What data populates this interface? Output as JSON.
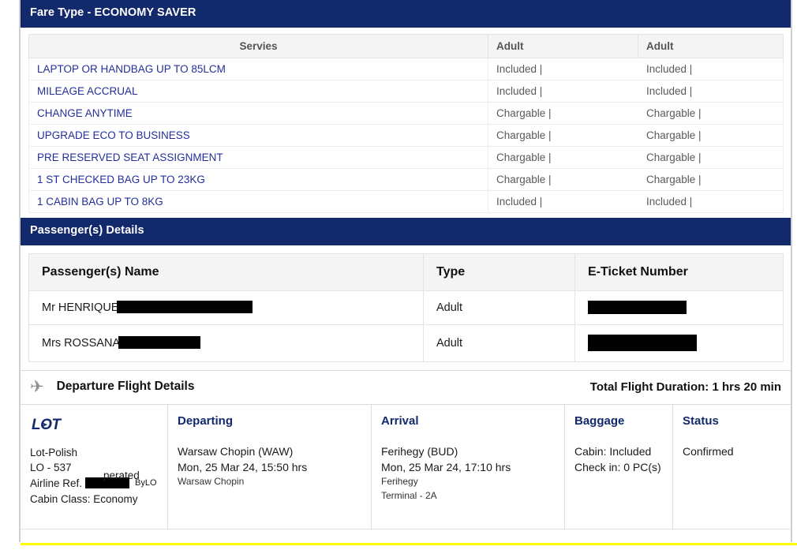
{
  "fare_section": {
    "title_prefix": "Fare Type",
    "title_dash": "-",
    "title_value": "ECONOMY SAVER",
    "columns": [
      "Servies",
      "Adult",
      "Adult"
    ],
    "rows": [
      {
        "service": "LAPTOP OR HANDBAG UP TO 85LCM",
        "adult1": "Included |",
        "adult2": "Included |"
      },
      {
        "service": "MILEAGE ACCRUAL",
        "adult1": "Included |",
        "adult2": "Included |"
      },
      {
        "service": "CHANGE ANYTIME",
        "adult1": "Chargable |",
        "adult2": "Chargable |"
      },
      {
        "service": "UPGRADE ECO TO BUSINESS",
        "adult1": "Chargable |",
        "adult2": "Chargable |"
      },
      {
        "service": "PRE RESERVED SEAT ASSIGNMENT",
        "adult1": "Chargable |",
        "adult2": "Chargable |"
      },
      {
        "service": "1 ST CHECKED BAG UP TO 23KG",
        "adult1": "Chargable |",
        "adult2": "Chargable |"
      },
      {
        "service": "1 CABIN BAG UP TO 8KG",
        "adult1": "Included |",
        "adult2": "Included |"
      }
    ]
  },
  "passenger_section": {
    "title": "Passenger(s) Details",
    "columns": [
      "Passenger(s) Name",
      "Type",
      "E-Ticket Number"
    ],
    "rows": [
      {
        "name_visible": "Mr HENRIQUE",
        "name_redacted": true,
        "type": "Adult",
        "eticket_redacted": true
      },
      {
        "name_visible": "Mrs ROSSANA",
        "name_redacted": true,
        "type": "Adult",
        "eticket_redacted": true
      }
    ]
  },
  "flight_section": {
    "icon": "airplane-icon",
    "title": "Departure Flight Details",
    "duration": "Total Flight Duration: 1 hrs 20 min",
    "airline": {
      "logo_text": "LOT",
      "name": "Lot-Polish",
      "flight_number": "LO - 537",
      "airline_ref_label": "Airline Ref.",
      "airline_ref_redacted": true,
      "operated_word": "perated",
      "operated_by": "ByLO",
      "cabin_class": "Cabin Class: Economy"
    },
    "departing": {
      "heading": "Departing",
      "airport": "Warsaw Chopin (WAW)",
      "datetime": "Mon, 25 Mar 24, 15:50 hrs",
      "terminal_name": "Warsaw Chopin"
    },
    "arrival": {
      "heading": "Arrival",
      "airport": "Ferihegy (BUD)",
      "datetime": "Mon, 25 Mar 24, 17:10 hrs",
      "terminal_name": "Ferihegy",
      "terminal": "Terminal - 2A"
    },
    "baggage": {
      "heading": "Baggage",
      "cabin": "Cabin: Included",
      "checkin": "Check in: 0 PC(s)"
    },
    "status": {
      "heading": "Status",
      "value": "Confirmed"
    }
  },
  "colors": {
    "navy": "#12296b",
    "link_blue": "#242f9b",
    "header_grey": "#f4f4f4",
    "yellow_rule": "#ffff00"
  }
}
